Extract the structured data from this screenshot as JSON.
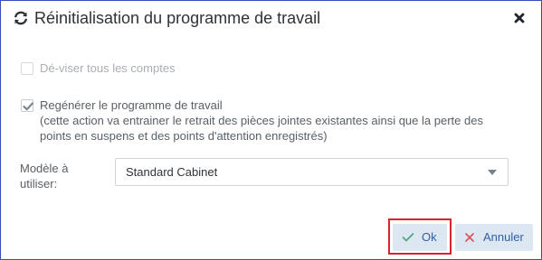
{
  "dialog": {
    "title": "Réinitialisation du programme de travail",
    "icons": {
      "title": "refresh-icon",
      "close": "close-icon"
    }
  },
  "options": {
    "devise": {
      "label": "Dé-viser tous les comptes",
      "checked": false,
      "disabled": true
    },
    "regenerer": {
      "label": "Regénérer le programme de travail",
      "checked": true,
      "description_line1": "(cette action va entrainer le retrait des pièces jointes existantes ainsi que la perte des",
      "description_line2": "points en suspens et des points d'attention enregistrés)"
    }
  },
  "modele": {
    "label_line1": "Modèle à",
    "label_line2": "utiliser:",
    "selected": "Standard Cabinet"
  },
  "buttons": {
    "ok": {
      "label": "Ok",
      "icon": "check-icon"
    },
    "cancel": {
      "label": "Annuler",
      "icon": "x-icon"
    }
  },
  "colors": {
    "dialog_border": "#2f4fb8",
    "button_bg": "#dde7f2",
    "button_text": "#2f5fa8",
    "check_green": "#4aa37a",
    "cancel_red": "#d9505a",
    "highlight": "#d9232d"
  }
}
